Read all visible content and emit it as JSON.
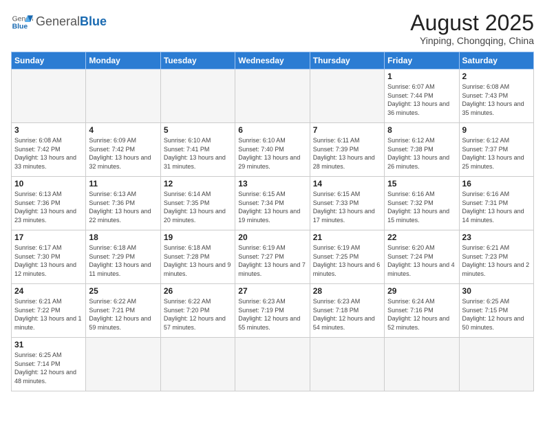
{
  "header": {
    "logo_general": "General",
    "logo_blue": "Blue",
    "month_title": "August 2025",
    "location": "Yinping, Chongqing, China"
  },
  "days_of_week": [
    "Sunday",
    "Monday",
    "Tuesday",
    "Wednesday",
    "Thursday",
    "Friday",
    "Saturday"
  ],
  "weeks": [
    [
      {
        "day": "",
        "info": ""
      },
      {
        "day": "",
        "info": ""
      },
      {
        "day": "",
        "info": ""
      },
      {
        "day": "",
        "info": ""
      },
      {
        "day": "",
        "info": ""
      },
      {
        "day": "1",
        "info": "Sunrise: 6:07 AM\nSunset: 7:44 PM\nDaylight: 13 hours and 36 minutes."
      },
      {
        "day": "2",
        "info": "Sunrise: 6:08 AM\nSunset: 7:43 PM\nDaylight: 13 hours and 35 minutes."
      }
    ],
    [
      {
        "day": "3",
        "info": "Sunrise: 6:08 AM\nSunset: 7:42 PM\nDaylight: 13 hours and 33 minutes."
      },
      {
        "day": "4",
        "info": "Sunrise: 6:09 AM\nSunset: 7:42 PM\nDaylight: 13 hours and 32 minutes."
      },
      {
        "day": "5",
        "info": "Sunrise: 6:10 AM\nSunset: 7:41 PM\nDaylight: 13 hours and 31 minutes."
      },
      {
        "day": "6",
        "info": "Sunrise: 6:10 AM\nSunset: 7:40 PM\nDaylight: 13 hours and 29 minutes."
      },
      {
        "day": "7",
        "info": "Sunrise: 6:11 AM\nSunset: 7:39 PM\nDaylight: 13 hours and 28 minutes."
      },
      {
        "day": "8",
        "info": "Sunrise: 6:12 AM\nSunset: 7:38 PM\nDaylight: 13 hours and 26 minutes."
      },
      {
        "day": "9",
        "info": "Sunrise: 6:12 AM\nSunset: 7:37 PM\nDaylight: 13 hours and 25 minutes."
      }
    ],
    [
      {
        "day": "10",
        "info": "Sunrise: 6:13 AM\nSunset: 7:36 PM\nDaylight: 13 hours and 23 minutes."
      },
      {
        "day": "11",
        "info": "Sunrise: 6:13 AM\nSunset: 7:36 PM\nDaylight: 13 hours and 22 minutes."
      },
      {
        "day": "12",
        "info": "Sunrise: 6:14 AM\nSunset: 7:35 PM\nDaylight: 13 hours and 20 minutes."
      },
      {
        "day": "13",
        "info": "Sunrise: 6:15 AM\nSunset: 7:34 PM\nDaylight: 13 hours and 19 minutes."
      },
      {
        "day": "14",
        "info": "Sunrise: 6:15 AM\nSunset: 7:33 PM\nDaylight: 13 hours and 17 minutes."
      },
      {
        "day": "15",
        "info": "Sunrise: 6:16 AM\nSunset: 7:32 PM\nDaylight: 13 hours and 15 minutes."
      },
      {
        "day": "16",
        "info": "Sunrise: 6:16 AM\nSunset: 7:31 PM\nDaylight: 13 hours and 14 minutes."
      }
    ],
    [
      {
        "day": "17",
        "info": "Sunrise: 6:17 AM\nSunset: 7:30 PM\nDaylight: 13 hours and 12 minutes."
      },
      {
        "day": "18",
        "info": "Sunrise: 6:18 AM\nSunset: 7:29 PM\nDaylight: 13 hours and 11 minutes."
      },
      {
        "day": "19",
        "info": "Sunrise: 6:18 AM\nSunset: 7:28 PM\nDaylight: 13 hours and 9 minutes."
      },
      {
        "day": "20",
        "info": "Sunrise: 6:19 AM\nSunset: 7:27 PM\nDaylight: 13 hours and 7 minutes."
      },
      {
        "day": "21",
        "info": "Sunrise: 6:19 AM\nSunset: 7:25 PM\nDaylight: 13 hours and 6 minutes."
      },
      {
        "day": "22",
        "info": "Sunrise: 6:20 AM\nSunset: 7:24 PM\nDaylight: 13 hours and 4 minutes."
      },
      {
        "day": "23",
        "info": "Sunrise: 6:21 AM\nSunset: 7:23 PM\nDaylight: 13 hours and 2 minutes."
      }
    ],
    [
      {
        "day": "24",
        "info": "Sunrise: 6:21 AM\nSunset: 7:22 PM\nDaylight: 13 hours and 1 minute."
      },
      {
        "day": "25",
        "info": "Sunrise: 6:22 AM\nSunset: 7:21 PM\nDaylight: 12 hours and 59 minutes."
      },
      {
        "day": "26",
        "info": "Sunrise: 6:22 AM\nSunset: 7:20 PM\nDaylight: 12 hours and 57 minutes."
      },
      {
        "day": "27",
        "info": "Sunrise: 6:23 AM\nSunset: 7:19 PM\nDaylight: 12 hours and 55 minutes."
      },
      {
        "day": "28",
        "info": "Sunrise: 6:23 AM\nSunset: 7:18 PM\nDaylight: 12 hours and 54 minutes."
      },
      {
        "day": "29",
        "info": "Sunrise: 6:24 AM\nSunset: 7:16 PM\nDaylight: 12 hours and 52 minutes."
      },
      {
        "day": "30",
        "info": "Sunrise: 6:25 AM\nSunset: 7:15 PM\nDaylight: 12 hours and 50 minutes."
      }
    ],
    [
      {
        "day": "31",
        "info": "Sunrise: 6:25 AM\nSunset: 7:14 PM\nDaylight: 12 hours and 48 minutes."
      },
      {
        "day": "",
        "info": ""
      },
      {
        "day": "",
        "info": ""
      },
      {
        "day": "",
        "info": ""
      },
      {
        "day": "",
        "info": ""
      },
      {
        "day": "",
        "info": ""
      },
      {
        "day": "",
        "info": ""
      }
    ]
  ]
}
